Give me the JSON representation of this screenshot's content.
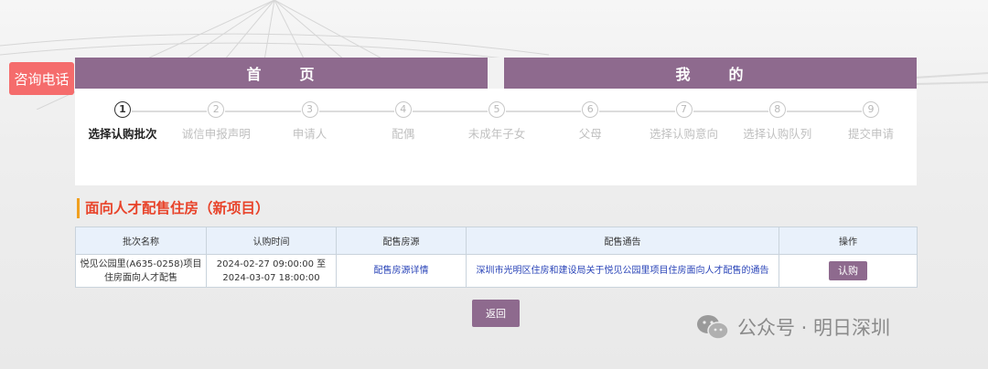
{
  "hotline": {
    "label": "咨询电话"
  },
  "nav": {
    "home": [
      "首",
      "页"
    ],
    "mine": [
      "我",
      "的"
    ]
  },
  "steps": [
    {
      "num": "1",
      "label": "选择认购批次",
      "active": true
    },
    {
      "num": "2",
      "label": "诚信申报声明"
    },
    {
      "num": "3",
      "label": "申请人"
    },
    {
      "num": "4",
      "label": "配偶"
    },
    {
      "num": "5",
      "label": "未成年子女"
    },
    {
      "num": "6",
      "label": "父母"
    },
    {
      "num": "7",
      "label": "选择认购意向"
    },
    {
      "num": "8",
      "label": "选择认购队列"
    },
    {
      "num": "9",
      "label": "提交申请"
    }
  ],
  "section": {
    "title": "面向人才配售住房（新项目）"
  },
  "table": {
    "headers": [
      "批次名称",
      "认购时间",
      "配售房源",
      "配售通告",
      "操作"
    ],
    "row": {
      "batch_name": "悦见公园里(A635-0258)项目住房面向人才配售",
      "time": "2024-02-27 09:00:00 至 2024-03-07 18:00:00",
      "source": "配售房源详情",
      "notice": "深圳市光明区住房和建设局关于悦见公园里项目住房面向人才配售的通告",
      "action": "认购"
    }
  },
  "back": {
    "label": "返回"
  },
  "watermark": {
    "text": "公众号 · 明日深圳"
  },
  "colors": {
    "accent": "#8e6a8e",
    "hotline": "#f56c6c",
    "title": "#e8432a"
  }
}
